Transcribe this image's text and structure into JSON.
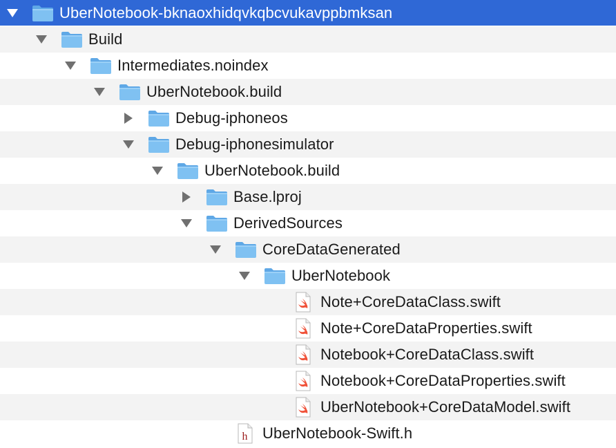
{
  "tree": {
    "rows": [
      {
        "label": "UberNotebook-bknaoxhidqvkqbcvukavppbmksan",
        "depth": 0,
        "type": "folder",
        "expanded": true,
        "selected": true
      },
      {
        "label": "Build",
        "depth": 1,
        "type": "folder",
        "expanded": true
      },
      {
        "label": "Intermediates.noindex",
        "depth": 2,
        "type": "folder",
        "expanded": true
      },
      {
        "label": "UberNotebook.build",
        "depth": 3,
        "type": "folder",
        "expanded": true
      },
      {
        "label": "Debug-iphoneos",
        "depth": 4,
        "type": "folder",
        "expanded": false
      },
      {
        "label": "Debug-iphonesimulator",
        "depth": 4,
        "type": "folder",
        "expanded": true
      },
      {
        "label": "UberNotebook.build",
        "depth": 5,
        "type": "folder",
        "expanded": true
      },
      {
        "label": "Base.lproj",
        "depth": 6,
        "type": "folder",
        "expanded": false
      },
      {
        "label": "DerivedSources",
        "depth": 6,
        "type": "folder",
        "expanded": true
      },
      {
        "label": "CoreDataGenerated",
        "depth": 7,
        "type": "folder",
        "expanded": true
      },
      {
        "label": "UberNotebook",
        "depth": 8,
        "type": "folder",
        "expanded": true
      },
      {
        "label": "Note+CoreDataClass.swift",
        "depth": 9,
        "type": "swift"
      },
      {
        "label": "Note+CoreDataProperties.swift",
        "depth": 9,
        "type": "swift"
      },
      {
        "label": "Notebook+CoreDataClass.swift",
        "depth": 9,
        "type": "swift"
      },
      {
        "label": "Notebook+CoreDataProperties.swift",
        "depth": 9,
        "type": "swift"
      },
      {
        "label": "UberNotebook+CoreDataModel.swift",
        "depth": 9,
        "type": "swift"
      },
      {
        "label": "UberNotebook-Swift.h",
        "depth": 7,
        "type": "header"
      }
    ]
  },
  "colors": {
    "selection": "#2f68d6",
    "stripe": "#f3f3f3",
    "folder": "#7fc1f2",
    "folder_tab": "#5fa8e6",
    "swift": "#f05138",
    "header_h": "#9b1b1b"
  },
  "icons": {
    "folder": "folder-icon",
    "swift": "swift-file-icon",
    "header": "header-file-icon",
    "expanded": "disclosure-triangle-down-icon",
    "collapsed": "disclosure-triangle-right-icon"
  }
}
